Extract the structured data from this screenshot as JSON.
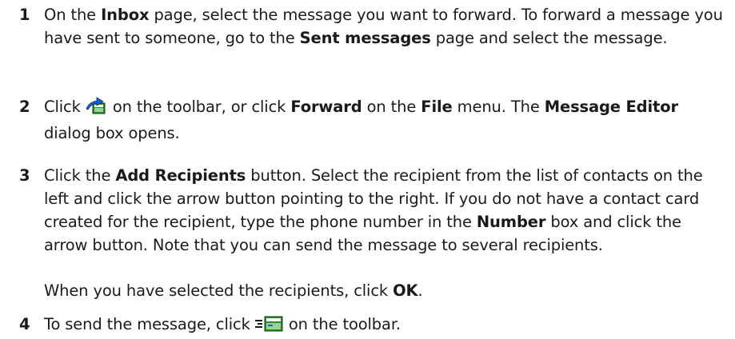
{
  "steps": [
    {
      "number": "1",
      "parts": [
        "On the ",
        "Inbox",
        " page, select the message you want to forward. To forward a message you have sent to someone, go to the ",
        "Sent messages",
        " page and select the message."
      ]
    },
    {
      "number": "2",
      "parts": [
        "Click ",
        " on the toolbar, or click ",
        "Forward",
        " on the ",
        "File",
        " menu. The ",
        "Message Editor",
        " dialog box opens."
      ],
      "icon": "forward-message-icon"
    },
    {
      "number": "3",
      "parts": [
        "Click the ",
        "Add Recipients",
        " button. Select the recipient from the list of contacts on the left and click the arrow button pointing to the right. If you do not have a contact card created for the recipient, type the phone number in the ",
        "Number",
        " box and click the arrow button. Note that you can send the message to several recipients."
      ],
      "note_parts": [
        "When you have selected the recipients, click ",
        "OK",
        "."
      ]
    },
    {
      "number": "4",
      "parts": [
        "To send the message, click ",
        " on the toolbar."
      ],
      "icon": "send-message-icon"
    }
  ]
}
